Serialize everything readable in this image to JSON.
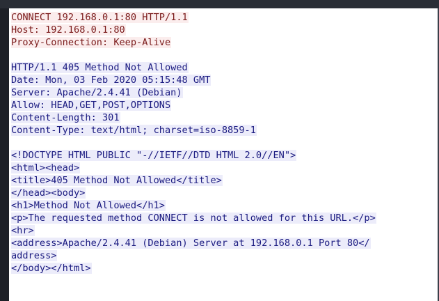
{
  "request": [
    "CONNECT 192.168.0.1:80 HTTP/1.1",
    "Host: 192.168.0.1:80",
    "Proxy-Connection: Keep-Alive"
  ],
  "response_headers": [
    "HTTP/1.1 405 Method Not Allowed",
    "Date: Mon, 03 Feb 2020 05:15:48 GMT",
    "Server: Apache/2.4.41 (Debian)",
    "Allow: HEAD,GET,POST,OPTIONS",
    "Content-Length: 301",
    "Content-Type: text/html; charset=iso-8859-1"
  ],
  "response_body": [
    "<!DOCTYPE HTML PUBLIC \"-//IETF//DTD HTML 2.0//EN\">",
    "<html><head>",
    "<title>405 Method Not Allowed</title>",
    "</head><body>",
    "<h1>Method Not Allowed</h1>",
    "<p>The requested method CONNECT is not allowed for this URL.</p>",
    "<hr>",
    "<address>Apache/2.4.41 (Debian) Server at 192.168.0.1 Port 80</",
    "address>",
    "</body></html>"
  ],
  "colors": {
    "client_text": "#7a1a1a",
    "client_bg": "#fbeded",
    "server_text": "#1a1a80",
    "server_bg": "#ececfa"
  }
}
